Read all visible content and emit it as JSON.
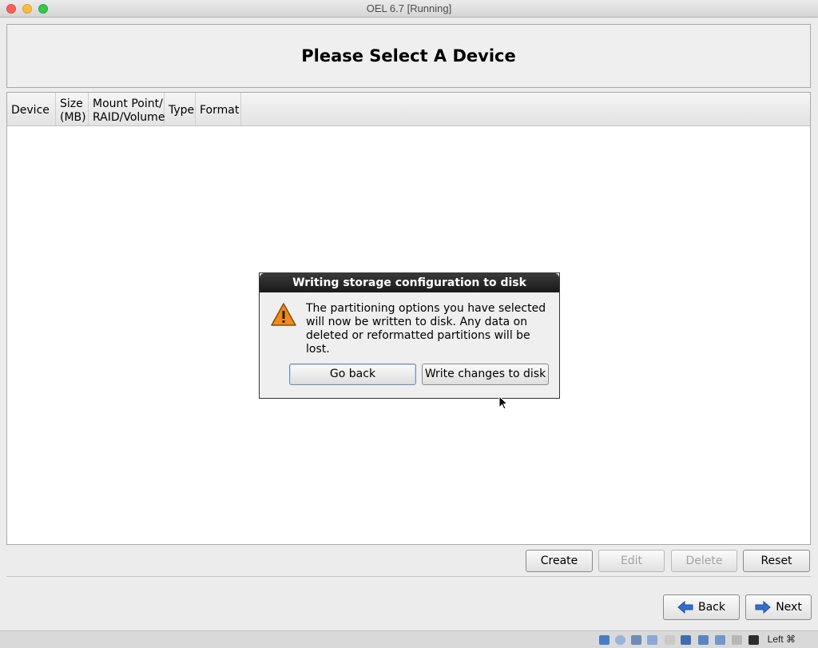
{
  "window": {
    "title": "OEL 6.7 [Running]"
  },
  "installer": {
    "page_title": "Please Select A Device",
    "columns": [
      {
        "label": "Device"
      },
      {
        "label": "Size\n(MB)"
      },
      {
        "label": "Mount Point/\nRAID/Volume"
      },
      {
        "label": "Type"
      },
      {
        "label": "Format"
      }
    ],
    "actions": {
      "create": "Create",
      "edit": "Edit",
      "delete": "Delete",
      "reset": "Reset"
    },
    "nav": {
      "back": "Back",
      "next": "Next"
    }
  },
  "dialog": {
    "title": "Writing storage configuration to disk",
    "message": "The partitioning options you have selected will now be written to disk.  Any data on deleted or reformatted partitions will be lost.",
    "go_back": "Go back",
    "write": "Write changes to disk"
  },
  "statusbar": {
    "host_key": "Left ⌘"
  },
  "icons": {
    "dialog": "warning-icon",
    "back": "arrow-left-icon",
    "next": "arrow-right-icon"
  },
  "colors": {
    "arrow_blue": "#2f6fcf",
    "warning_orange": "#f08a1c"
  }
}
